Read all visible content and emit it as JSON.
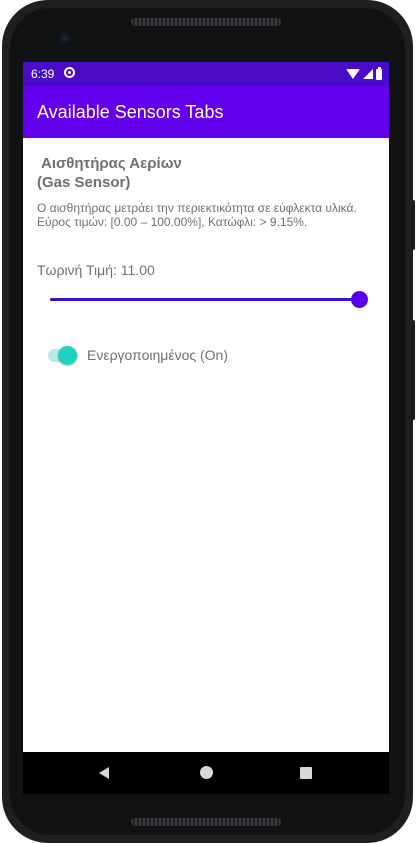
{
  "status_bar": {
    "time": "6:39",
    "icons": [
      "sync-icon",
      "wifi-icon",
      "signal-icon",
      "battery-icon"
    ],
    "color": "#4a0bc9"
  },
  "app_bar": {
    "title": "Available Sensors Tabs",
    "color": "#6200ee"
  },
  "sensor": {
    "title_line1": "Αισθητήρας Αερίων",
    "title_line2": "(Gas Sensor)",
    "description_line1": "Ο αισθητήρας μετράει την περιεκτικότητα σε εύφλεκτα υλικά.",
    "description_line2": "Εύρος τιμών: [0.00 – 100.00%], Κατώφλι: > 9.15%.",
    "current_value_label": "Τωρινή Τιμή:",
    "current_value": "11.00",
    "slider_fraction": 1.0,
    "accent_color": "#6200ee"
  },
  "toggle": {
    "label": "Ενεργοποιημένος (On)",
    "state": "on",
    "color": "#1fd1c1"
  },
  "nav_bar": {
    "icons": [
      "back-icon",
      "home-icon",
      "recents-icon"
    ]
  }
}
